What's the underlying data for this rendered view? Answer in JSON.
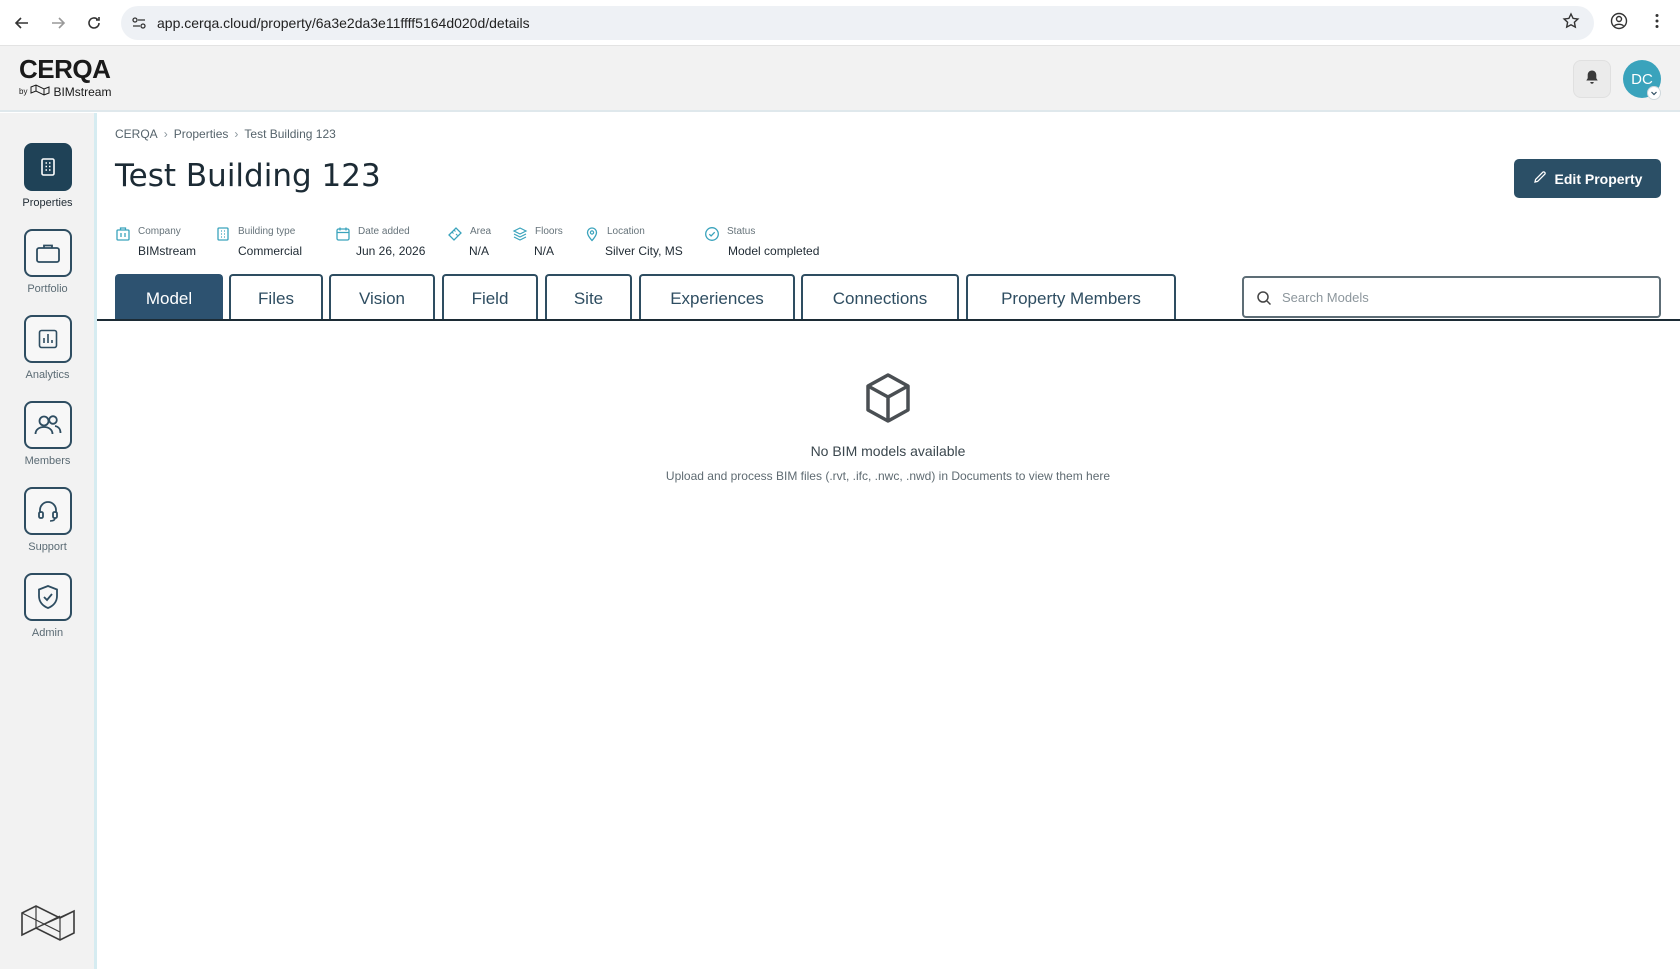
{
  "browser": {
    "url": "app.cerqa.cloud/property/6a3e2da3e11ffff5164d020d/details"
  },
  "header": {
    "logo_main": "CERQA",
    "logo_by": "by",
    "logo_sub": "BIMstream",
    "avatar_initials": "DC"
  },
  "sidebar": {
    "items": [
      {
        "label": "Properties",
        "icon": "building-icon",
        "active": true
      },
      {
        "label": "Portfolio",
        "icon": "briefcase-icon",
        "active": false
      },
      {
        "label": "Analytics",
        "icon": "chart-icon",
        "active": false
      },
      {
        "label": "Members",
        "icon": "users-icon",
        "active": false
      },
      {
        "label": "Support",
        "icon": "headset-icon",
        "active": false
      },
      {
        "label": "Admin",
        "icon": "shield-check-icon",
        "active": false
      }
    ]
  },
  "breadcrumb": [
    "CERQA",
    "Properties",
    "Test Building 123"
  ],
  "page": {
    "title": "Test Building 123",
    "edit_button": "Edit Property"
  },
  "meta": [
    {
      "label": "Company",
      "value": "BIMstream",
      "icon": "building-icon"
    },
    {
      "label": "Building type",
      "value": "Commercial",
      "icon": "office-icon"
    },
    {
      "label": "Date added",
      "value": "Jun 26, 2026",
      "icon": "calendar-icon"
    },
    {
      "label": "Area",
      "value": "N/A",
      "icon": "ruler-icon"
    },
    {
      "label": "Floors",
      "value": "N/A",
      "icon": "layers-icon"
    },
    {
      "label": "Location",
      "value": "Silver City, MS",
      "icon": "pin-icon"
    },
    {
      "label": "Status",
      "value": "Model completed",
      "icon": "check-circle-icon"
    }
  ],
  "tabs": [
    "Model",
    "Files",
    "Vision",
    "Field",
    "Site",
    "Experiences",
    "Connections",
    "Property Members"
  ],
  "active_tab": "Model",
  "search": {
    "placeholder": "Search Models",
    "value": ""
  },
  "empty_state": {
    "icon": "cube-icon",
    "title": "No BIM models available",
    "description": "Upload and process BIM files (.rvt, .ifc, .nwc, .nwd) in Documents to view them here"
  },
  "colors": {
    "primary": "#2b4f66",
    "accent": "#3aa3bc",
    "sidebar_bg": "#f2f2f2"
  }
}
